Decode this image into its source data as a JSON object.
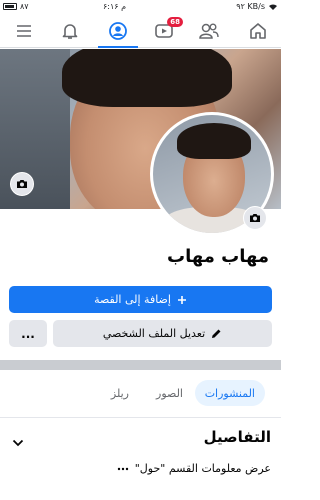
{
  "status_bar": {
    "network": "۹۲ KB/s",
    "time": "۶:۱۶ م",
    "battery": "۸۷"
  },
  "nav": {
    "notifications_badge": "68",
    "active_tab": "profile"
  },
  "profile": {
    "name": "مهاب مهاب"
  },
  "actions": {
    "add_story": "إضافة إلى القصة",
    "edit_profile": "تعديل الملف الشخصي",
    "more": "..."
  },
  "tabs": [
    {
      "label": "المنشورات",
      "active": true
    },
    {
      "label": "الصور",
      "active": false
    },
    {
      "label": "ريلز",
      "active": false
    }
  ],
  "details": {
    "title": "التفاصيل",
    "item": "عرض معلومات القسم \"حول\""
  },
  "colors": {
    "primary": "#1877f2",
    "badge": "#e41e3f",
    "button_gray": "#e4e6eb"
  }
}
